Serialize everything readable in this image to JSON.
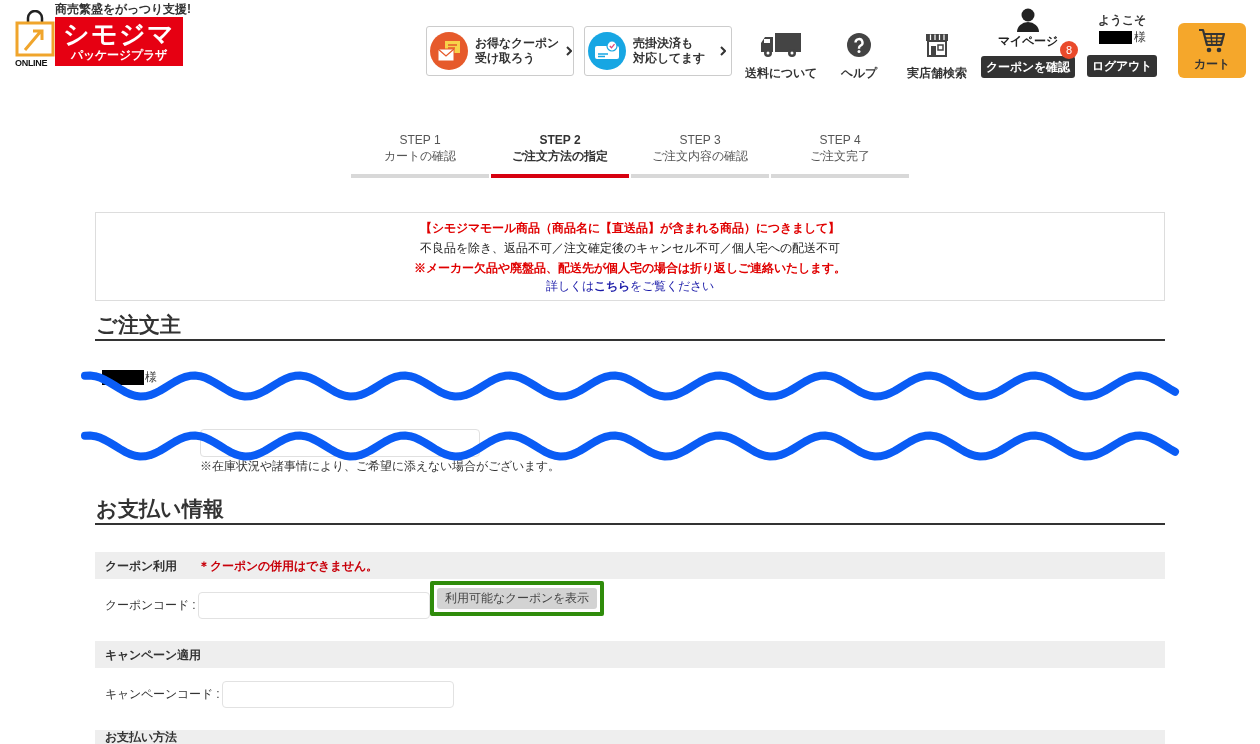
{
  "header": {
    "logo": {
      "tagline": "商売繁盛をがっつり支援!",
      "badge": "ONLINE",
      "name": "シモジマ",
      "subname": "パッケージプラザ"
    },
    "promos": [
      {
        "kind": "coupon",
        "lines": [
          "お得なクーポン",
          "受け取ろう"
        ]
      },
      {
        "kind": "invoice",
        "lines": [
          "売掛決済も",
          "対応してます"
        ]
      }
    ],
    "nav": [
      {
        "kind": "truck",
        "label": "送料について"
      },
      {
        "kind": "help",
        "label": "ヘルプ"
      },
      {
        "kind": "store",
        "label": "実店舗検索"
      }
    ],
    "mypage": {
      "label": "マイページ",
      "button": "クーポンを確認",
      "badge": "8"
    },
    "user": {
      "greeting": "ようこそ",
      "name_redacted": true,
      "suffix": "様",
      "logout": "ログアウト"
    },
    "cart": {
      "label": "カート"
    }
  },
  "steps": [
    {
      "step": "STEP 1",
      "label": "カートの確認",
      "selected": false
    },
    {
      "step": "STEP 2",
      "label": "ご注文方法の指定",
      "selected": true
    },
    {
      "step": "STEP 3",
      "label": "ご注文内容の確認",
      "selected": false
    },
    {
      "step": "STEP 4",
      "label": "ご注文完了",
      "selected": false
    }
  ],
  "notice": {
    "title": "【シモジマモール商品（商品名に【直送品】が含まれる商品）につきまして】",
    "rule": "不良品を除き、返品不可／注文確定後のキャンセル不可／個人宅への配送不可",
    "warning": "※メーカー欠品や廃盤品、配送先が個人宅の場合は折り返しご連絡いたします。",
    "link": "詳しくは**こちら**をご覧ください"
  },
  "orderer": {
    "heading": "ご注文主",
    "name_redacted": true,
    "suffix": "様",
    "note": "※在庫状況や諸事情により、ご希望に添えない場合がございます。"
  },
  "scribbles": [
    {
      "kind": "wave"
    },
    {
      "kind": "wave"
    }
  ],
  "payment": {
    "heading": "お支払い情報",
    "sections": [
      {
        "title": "クーポン利用",
        "note": "＊クーポンの併用はできません。",
        "field_label": "クーポンコード :",
        "button": {
          "label": "利用可能なクーポンを表示",
          "highlighted": true
        }
      },
      {
        "title": "キャンペーン適用",
        "field_label": "キャンペーンコード :"
      },
      {
        "title": "お支払い方法"
      }
    ]
  }
}
